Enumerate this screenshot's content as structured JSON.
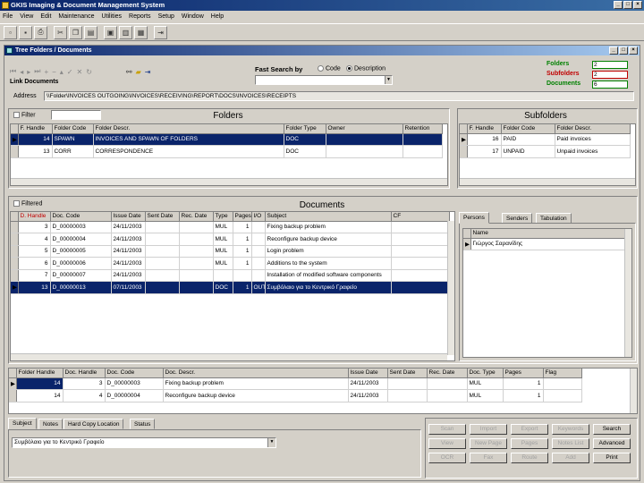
{
  "app": {
    "title": "GKIS Imaging & Document Management System"
  },
  "menu": [
    "File",
    "View",
    "Edit",
    "Maintenance",
    "Utilities",
    "Reports",
    "Setup",
    "Window",
    "Help"
  ],
  "child_window": {
    "title": "Tree Folders / Documents"
  },
  "link_documents_label": "Link Documents",
  "fast_search": {
    "label": "Fast Search by",
    "options": [
      "Code",
      "Description"
    ],
    "selected": "Description",
    "value": ""
  },
  "counts": {
    "folders_label": "Folders",
    "folders_value": "2",
    "subfolders_label": "Subfolders",
    "subfolders_value": "2",
    "documents_label": "Documents",
    "documents_value": "6",
    "colors": {
      "folders": "#008000",
      "subfolders": "#c00000",
      "documents": "#008000"
    }
  },
  "address": {
    "label": "Address",
    "value": "\\\\Folder\\INVOICES OUTGOING\\INVOICES\\RECEIVING\\REPORT\\DOCS\\INVOICES\\RECEIPTS"
  },
  "folders": {
    "title": "Folders",
    "filter_label": "Filter",
    "columns": [
      "F. Handle",
      "Folder Code",
      "Folder Descr.",
      "Folder Type",
      "Owner",
      "Retention"
    ],
    "rows": [
      [
        "14",
        "SPAWN",
        "INVOICES AND SPAWN OF FOLDERS",
        "DOC",
        "",
        ""
      ],
      [
        "13",
        "CORR",
        "CORRESPONDENCE",
        "DOC",
        "",
        ""
      ]
    ]
  },
  "subfolders": {
    "title": "Subfolders",
    "columns": [
      "F. Handle",
      "Folder Code",
      "Folder Descr."
    ],
    "rows": [
      [
        "16",
        "PAID",
        "Paid invoices"
      ],
      [
        "17",
        "UNPAID",
        "Unpaid invoices"
      ]
    ]
  },
  "documents": {
    "title": "Documents",
    "filter_label": "Filtered",
    "columns": [
      "D. Handle",
      "Doc. Code",
      "Issue Date",
      "Sent Date",
      "Rec. Date",
      "Type",
      "Pages",
      "I/O",
      "Subject",
      "CF"
    ],
    "rows": [
      [
        "3",
        "D_00000003",
        "24/11/2003",
        "",
        "",
        "MUL",
        "1",
        "",
        "Fixing backup problem",
        ""
      ],
      [
        "4",
        "D_00000004",
        "24/11/2003",
        "",
        "",
        "MUL",
        "1",
        "",
        "Reconfigure backup device",
        ""
      ],
      [
        "5",
        "D_00000005",
        "24/11/2003",
        "",
        "",
        "MUL",
        "1",
        "",
        "Login problem",
        ""
      ],
      [
        "6",
        "D_00000006",
        "24/11/2003",
        "",
        "",
        "MUL",
        "1",
        "",
        "Additions to the system",
        ""
      ],
      [
        "7",
        "D_00000007",
        "24/11/2003",
        "",
        "",
        "",
        "",
        "",
        "Installation of modified software components",
        ""
      ],
      [
        "13",
        "D_00000013",
        "07/11/2003",
        "",
        "",
        "DOC",
        "1",
        "OUT",
        "Συμβόλαιο για το Κεντρικό Γραφείο",
        ""
      ]
    ]
  },
  "persons_tabs": [
    "Persons",
    "Senders",
    "Tabulation"
  ],
  "persons": {
    "columns": [
      "Name"
    ],
    "rows": [
      [
        "Γιώργος Σαρανίδης"
      ]
    ]
  },
  "linked": {
    "columns": [
      "Folder Handle",
      "Doc. Handle",
      "Doc. Code",
      "Doc. Descr.",
      "Issue Date",
      "Sent Date",
      "Rec. Date",
      "Doc. Type",
      "Pages",
      "Flag"
    ],
    "rows": [
      [
        "14",
        "3",
        "D_00000003",
        "Fixing backup problem",
        "24/11/2003",
        "",
        "",
        "MUL",
        "1",
        ""
      ],
      [
        "14",
        "4",
        "D_00000004",
        "Reconfigure backup device",
        "24/11/2003",
        "",
        "",
        "MUL",
        "1",
        ""
      ]
    ]
  },
  "bottom_tabs": [
    "Subject",
    "Notes",
    "Hard Copy Location",
    "Status"
  ],
  "subject_value": "Συμβόλαιο για το Κεντρικό Γραφείο",
  "buttons": [
    [
      "Scan",
      "Import",
      "Export",
      "Keywords",
      "Search"
    ],
    [
      "View",
      "New Page",
      "Pages",
      "Notes List",
      "Advanced"
    ],
    [
      "OCR",
      "Fax",
      "Route",
      "Add",
      "Print"
    ]
  ]
}
